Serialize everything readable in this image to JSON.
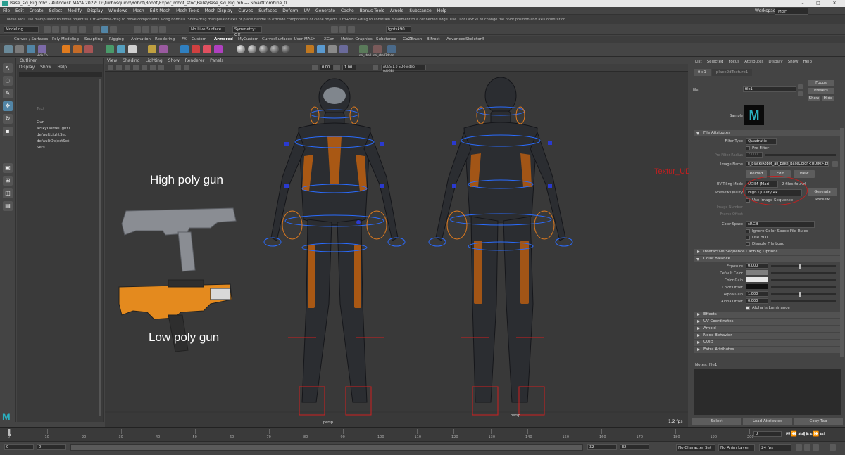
{
  "window": {
    "title": "Base_ski_Rig.mb* - Autodesk MAYA 2022: D:\\turbosquidd\\Robot\\Robot\\Expor_robot_stoc\\Faile\\Base_ski_Rig.mb  ---  SmartCombine_0"
  },
  "menubar": [
    "File",
    "Edit",
    "Create",
    "Select",
    "Modify",
    "Display",
    "Windows",
    "Mesh",
    "Edit Mesh",
    "Mesh Tools",
    "Mesh Display",
    "Curves",
    "Surfaces",
    "Deform",
    "UV",
    "Generate",
    "Cache",
    "Bonus Tools",
    "Arnold",
    "Substance",
    "Help"
  ],
  "workspace": {
    "label": "Workspace :",
    "value": "MGF"
  },
  "helpline": "Move Tool: Use manipulator to move object(s). Ctrl+middle-drag to move components along normals. Shift+drag manipulator axis or plane handle to extrude components or clone objects. Ctrl+Shift+drag to constrain movement to a connected edge. Use D or INSERT to change the pivot position and axis orientation.",
  "status": {
    "menuset": "Modeling",
    "live": "No Live Surface",
    "symmetry": "Symmetry: Off",
    "field": "lgntsk90"
  },
  "shelf_tabs": [
    "Curves / Surfaces",
    "Poly Modeling",
    "Sculpting",
    "Rigging",
    "Animation",
    "Rendering",
    "FX",
    "Custom",
    "Armored",
    "MyCustom",
    "CurvesSurfaces_User",
    "MASH",
    "XGen",
    "Motion Graphics",
    "Substance",
    "GoZBrush",
    "BiFrost",
    "AdvancedSkeleton5"
  ],
  "shelf_icon_labels": [
    "Hide Ch",
    "sel_shell",
    "sel_shell3dpan"
  ],
  "outliner": {
    "title": "Outliner",
    "menu": [
      "Display",
      "Show",
      "Help"
    ],
    "items": [
      "Text",
      "Gun",
      "aiSkyDomeLight1",
      "defaultLightSet",
      "defaultObjectSet",
      "Sets"
    ]
  },
  "viewport": {
    "menu": [
      "View",
      "Shading",
      "Lighting",
      "Show",
      "Renderer",
      "Panels"
    ],
    "num_a": "0.00",
    "num_b": "1.00",
    "colorspace": "ACES 1.0 SDR-video (sRGB)",
    "camera_left": "persp",
    "camera_right": "persp",
    "fps": "1.2 fps",
    "label_high": "High poly gun",
    "label_low": "Low poly gun",
    "red_note": "Textur_UDIM"
  },
  "attr": {
    "menu": [
      "List",
      "Selected",
      "Focus",
      "Attributes",
      "Display",
      "Show",
      "Help"
    ],
    "tabs": [
      "file1",
      "place2dTexture1"
    ],
    "file_label": "file:",
    "file_value": "file1",
    "focus": "Focus",
    "presets": "Presets",
    "show": "Show",
    "hide": "Hide",
    "sample": "Sample",
    "sections": {
      "file_attributes": "File Attributes",
      "interactive": "Interactive Sequence Caching Options",
      "color_balance": "Color Balance",
      "effects": "Effects",
      "uv_coordinates": "UV Coordinates",
      "arnold": "Arnold",
      "node_behavior": "Node Behavior",
      "uuid": "UUID",
      "extra": "Extra Attributes"
    },
    "filter_type": {
      "label": "Filter Type",
      "value": "Quadratic"
    },
    "pre_filter": "Pre Filter",
    "pre_filter_radius": {
      "label": "Pre Filter Radius",
      "value": "2.000"
    },
    "image_name": {
      "label": "Image Name",
      "value": "il_black\\Robot_all_bake_BaseColor.<UDIM>.png"
    },
    "reload": "Reload",
    "edit": "Edit",
    "view": "View",
    "uv_tiling": {
      "label": "UV Tiling Mode",
      "value": "UDIM (Mari)",
      "note": "2 files found"
    },
    "preview_quality": {
      "label": "Preview Quality",
      "value": "High Quality 4k"
    },
    "generate": "Generate Preview",
    "use_image_seq": "Use Image Sequence",
    "image_number": "Image Number",
    "frame_offset": "Frame Offset",
    "color_space": {
      "label": "Color Space",
      "value": "sRGB"
    },
    "ignore_cs": "Ignore Color Space File Rules",
    "use_bot": "Use BOT",
    "disable_file_load": "Disable File Load",
    "exposure": {
      "label": "Exposure",
      "value": "0.000"
    },
    "default_color": "Default Color",
    "color_gain": "Color Gain",
    "color_offset": "Color Offset",
    "alpha_gain": {
      "label": "Alpha Gain",
      "value": "1.000"
    },
    "alpha_offset": {
      "label": "Alpha Offset",
      "value": "0.000"
    },
    "alpha_lum": "Alpha Is Luminance",
    "notes": "Notes:  file1",
    "select": "Select",
    "load": "Load Attributes",
    "copy": "Copy Tab"
  },
  "timeline": {
    "start": "0",
    "ticks": [
      "0",
      "10",
      "20",
      "30",
      "40",
      "50",
      "60",
      "70",
      "80",
      "90",
      "100",
      "110",
      "120",
      "130",
      "140",
      "150",
      "160",
      "170",
      "180",
      "190",
      "200"
    ],
    "current": "0"
  },
  "range": {
    "a": "0",
    "b": "0",
    "c": "32",
    "d": "32",
    "char_set": "No Character Set",
    "anim_layer": "No Anim Layer",
    "fps": "24 fps"
  },
  "colors": {
    "accent": "#5285a6",
    "orange": "#e07b1e",
    "red": "#c02020",
    "rig_blue": "#2255ff"
  }
}
